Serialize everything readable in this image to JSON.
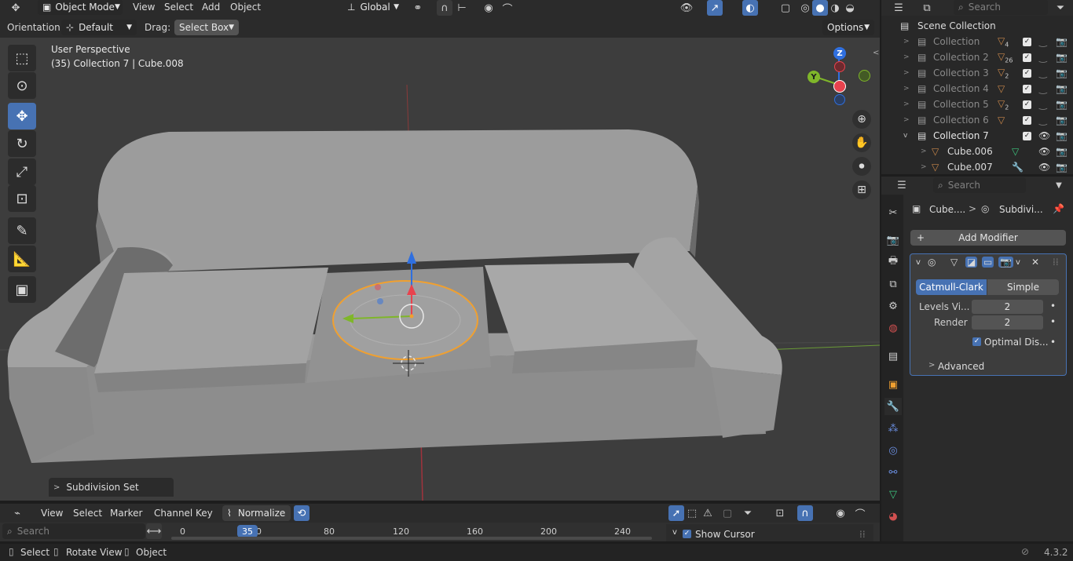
{
  "viewport_header": {
    "mode_label": "Object Mode",
    "menus": [
      "View",
      "Select",
      "Add",
      "Object"
    ],
    "transform_orientation": "Global"
  },
  "tool_settings": {
    "orientation_label": "Orientation:",
    "orientation_value": "Default",
    "drag_label": "Drag:",
    "drag_value": "Select Box",
    "options_label": "Options"
  },
  "viewport": {
    "perspective": "User Perspective",
    "object_info": "(35) Collection 7 | Cube.008",
    "gizmo_axes": [
      "Z",
      "Y",
      "X"
    ],
    "last_operator": "Subdivision Set"
  },
  "outliner": {
    "search_placeholder": "Search",
    "root": "Scene Collection",
    "rows": [
      {
        "label": "Collection",
        "count": "4"
      },
      {
        "label": "Collection 2",
        "count": "26"
      },
      {
        "label": "Collection 3",
        "count": "2"
      },
      {
        "label": "Collection 4",
        "count": ""
      },
      {
        "label": "Collection 5",
        "count": "2"
      },
      {
        "label": "Collection 6",
        "count": ""
      },
      {
        "label": "Collection 7",
        "count": ""
      },
      {
        "label": "Cube.006",
        "count": ""
      },
      {
        "label": "Cube.007",
        "count": ""
      }
    ]
  },
  "properties": {
    "search_placeholder": "Search",
    "breadcrumb_object": "Cube....",
    "breadcrumb_modifier": "Subdivi...",
    "add_modifier": "Add Modifier",
    "tab_catmull": "Catmull-Clark",
    "tab_simple": "Simple",
    "levels_label": "Levels Vi...",
    "levels_value": "2",
    "render_label": "Render",
    "render_value": "2",
    "optimal_label": "Optimal Dis...",
    "advanced_label": "Advanced"
  },
  "timeline": {
    "menus": [
      "View",
      "Select",
      "Marker",
      "Channel",
      "Key"
    ],
    "normalize_label": "Normalize",
    "search_placeholder": "Search",
    "current_frame": "35",
    "ticks": [
      "0",
      "0",
      "80",
      "120",
      "160",
      "200",
      "240"
    ],
    "show_cursor_label": "Show Cursor"
  },
  "status_bar": {
    "items": [
      "Select",
      "Rotate View",
      "Object"
    ],
    "version": "4.3.2"
  },
  "colors": {
    "accent": "#4772b3",
    "selection": "#f0a030",
    "axis_x": "#e8434e",
    "axis_y": "#7fb62a",
    "axis_z": "#2f6fdf"
  }
}
